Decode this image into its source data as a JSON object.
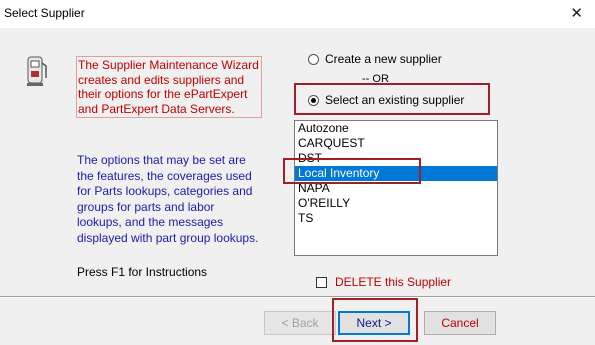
{
  "window": {
    "title": "Select Supplier",
    "close_glyph": "✕"
  },
  "description": {
    "wizard_text": "The Supplier Maintenance Wizard\ncreates and edits suppliers and\ntheir options for the ePartExpert\nand PartExpert Data Servers.",
    "options_text": "The options that may be set are\nthe features, the coverages used\nfor Parts lookups, categories and\ngroups for parts and labor\nlookups, and the messages\ndisplayed with part group lookups.",
    "help_text": "Press F1 for Instructions"
  },
  "mode": {
    "create_label": "Create a new supplier",
    "or_label": "-- OR",
    "select_label": "Select an existing supplier",
    "selected": "select"
  },
  "suppliers": {
    "items": [
      "Autozone",
      "CARQUEST",
      "DST",
      "Local Inventory",
      "NAPA",
      "O'REILLY",
      "TS"
    ],
    "selected": "Local Inventory"
  },
  "delete_label": "DELETE this Supplier",
  "buttons": {
    "back": "< Back",
    "next": "Next >",
    "cancel": "Cancel"
  },
  "colors": {
    "accent": "#0078d7",
    "highlight_box": "#a0202a",
    "red_text": "#c00000",
    "blue_text": "#1c1cac"
  }
}
